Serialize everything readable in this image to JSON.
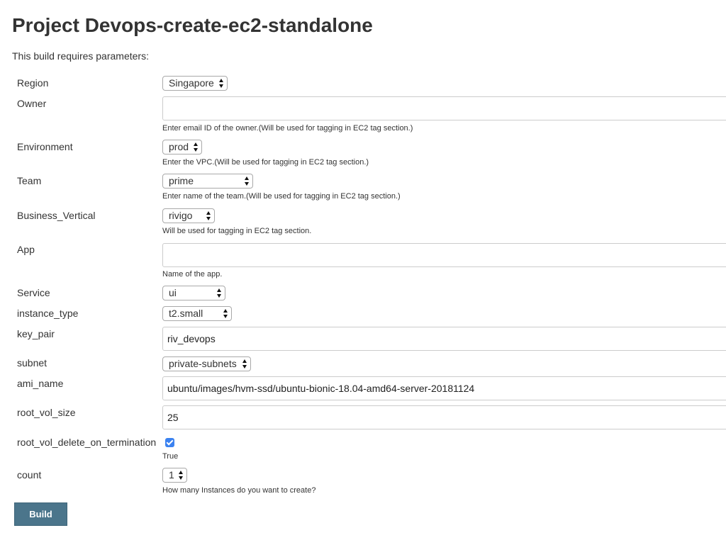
{
  "title": "Project Devops-create-ec2-standalone",
  "intro": "This build requires parameters:",
  "params": {
    "region": {
      "label": "Region",
      "value": "Singapore"
    },
    "owner": {
      "label": "Owner",
      "value": "",
      "description": "Enter email ID of the owner.(Will be used for tagging in EC2 tag section.)"
    },
    "environment": {
      "label": "Environment",
      "value": "prod",
      "description": "Enter the VPC.(Will be used for tagging in EC2 tag section.)"
    },
    "team": {
      "label": "Team",
      "value": "prime",
      "description": "Enter name of the team.(Will be used for tagging in EC2 tag section.)"
    },
    "business_vertical": {
      "label": "Business_Vertical",
      "value": "rivigo",
      "description": "Will be used for tagging in EC2 tag section."
    },
    "app": {
      "label": "App",
      "value": "",
      "description": "Name of the app."
    },
    "service": {
      "label": "Service",
      "value": "ui"
    },
    "instance_type": {
      "label": "instance_type",
      "value": "t2.small"
    },
    "key_pair": {
      "label": "key_pair",
      "value": "riv_devops"
    },
    "subnet": {
      "label": "subnet",
      "value": "private-subnets"
    },
    "ami_name": {
      "label": "ami_name",
      "value": "ubuntu/images/hvm-ssd/ubuntu-bionic-18.04-amd64-server-20181124"
    },
    "root_vol_size": {
      "label": "root_vol_size",
      "value": "25"
    },
    "root_vol_delete_on_termination": {
      "label": "root_vol_delete_on_termination",
      "checked": true,
      "description": "True"
    },
    "count": {
      "label": "count",
      "value": "1",
      "description": "How many Instances do you want to create?"
    }
  },
  "build_button": "Build",
  "colors": {
    "button_bg": "#4b758b",
    "checkbox": "#3b82f0",
    "text": "#333333"
  }
}
